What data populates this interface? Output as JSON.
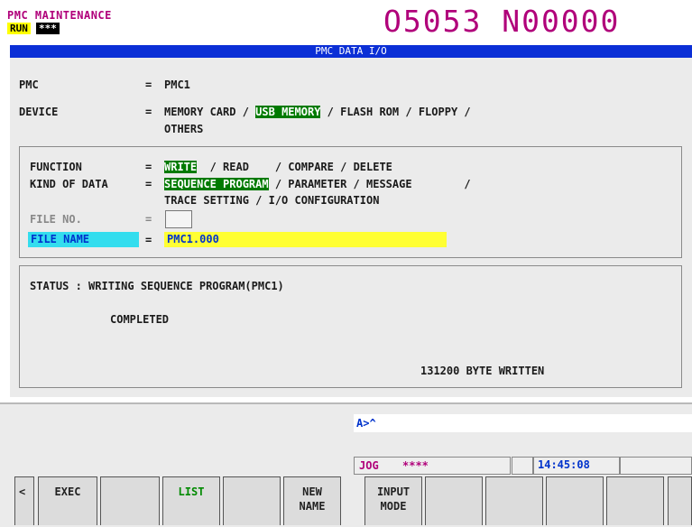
{
  "header": {
    "mode_title": "PMC MAINTENANCE",
    "run_badge": "RUN",
    "alarm_badge": "***",
    "program_number": "O5053 N00000"
  },
  "screen_title": "PMC DATA I/O",
  "pmc": {
    "label": "PMC",
    "eq": "=",
    "value": "PMC1"
  },
  "device": {
    "label": "DEVICE",
    "eq": "=",
    "options": [
      "MEMORY CARD",
      "USB MEMORY",
      "FLASH ROM",
      "FLOPPY",
      "OTHERS"
    ],
    "selected": "USB MEMORY"
  },
  "function": {
    "label": "FUNCTION",
    "eq": "=",
    "options": [
      "WRITE",
      "READ",
      "COMPARE",
      "DELETE"
    ],
    "selected": "WRITE"
  },
  "kind_of_data": {
    "label": "KIND OF DATA",
    "eq": "=",
    "options": [
      "SEQUENCE PROGRAM",
      "PARAMETER",
      "MESSAGE",
      "TRACE SETTING",
      "I/O CONFIGURATION"
    ],
    "selected": "SEQUENCE PROGRAM"
  },
  "file_no": {
    "label": "FILE NO.",
    "eq": "=",
    "value": ""
  },
  "file_name": {
    "label": "FILE NAME",
    "eq": "=",
    "value": "PMC1.000"
  },
  "status": {
    "label": "STATUS :",
    "message": "WRITING SEQUENCE PROGRAM(PMC1)",
    "result": "COMPLETED",
    "bytes": "131200 BYTE WRITTEN"
  },
  "key_input": "A>^",
  "status_line": {
    "mode": "JOG",
    "stars": "****",
    "time": "14:45:08"
  },
  "softkeys": {
    "left_arrow": "<",
    "k1": "EXEC",
    "k2": "",
    "k3": "LIST",
    "k4": "",
    "k5_line1": "NEW",
    "k5_line2": "NAME",
    "k6_line1": "INPUT",
    "k6_line2": "MODE",
    "k7": "",
    "k8": "",
    "k9": "",
    "k10": ""
  },
  "colors": {
    "title_bar": "#0b2fd6",
    "selected": "#007a00",
    "file_name_label_bg": "#33ddee",
    "input_bg": "#ffff33",
    "magenta": "#b0007a"
  }
}
